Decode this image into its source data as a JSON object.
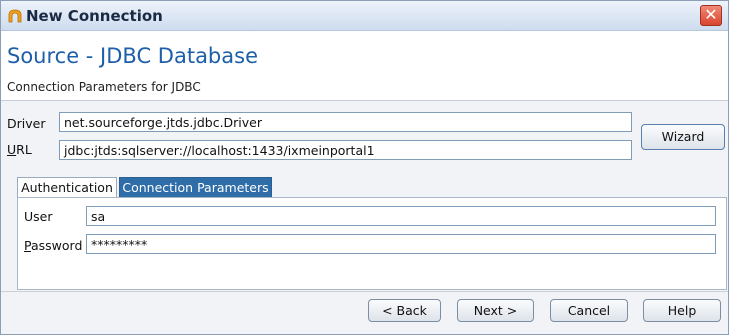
{
  "window": {
    "title": "New Connection"
  },
  "header": {
    "title": "Source - JDBC Database",
    "subtitle": "Connection Parameters for JDBC"
  },
  "driver": {
    "label": "Driver",
    "value": "net.sourceforge.jtds.jdbc.Driver"
  },
  "url": {
    "label_first": "U",
    "label_rest": "RL",
    "value": "jdbc:jtds:sqlserver://localhost:1433/ixmeinportal1"
  },
  "wizard_label": "Wizard",
  "tabs": [
    {
      "label": "Authentication",
      "selected": true
    },
    {
      "label": "Connection Parameters",
      "selected": false
    }
  ],
  "auth": {
    "user_label": "User",
    "user_value": "sa",
    "password_label_first": "P",
    "password_label_rest": "assword",
    "password_value": "*********"
  },
  "footer": {
    "back": "< Back",
    "next": "Next >",
    "cancel": "Cancel",
    "help": "Help"
  },
  "colors": {
    "accent": "#1d5fa8",
    "tab_inactive": "#2e6da8",
    "close": "#d9442e"
  }
}
